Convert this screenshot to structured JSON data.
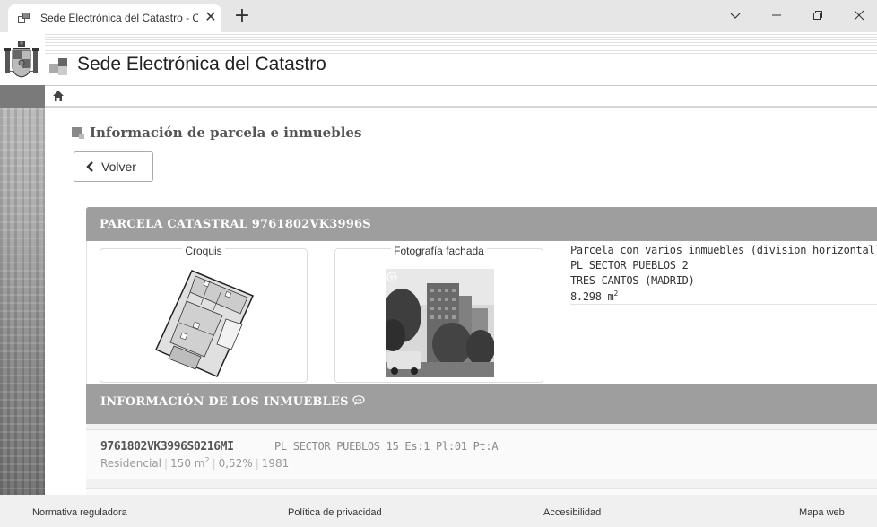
{
  "browser": {
    "tab_title": "Sede Electrónica del Catastro - C",
    "tab_close": "✕",
    "new_tab": "+"
  },
  "header": {
    "site_name": "Sede Electrónica del Catastro"
  },
  "page": {
    "title": "Información de parcela e inmuebles",
    "back_label": "Volver"
  },
  "parcel": {
    "heading": "PARCELA CATASTRAL 9761802VK3996S",
    "croquis_label": "Croquis",
    "photo_label": "Fotografía fachada",
    "description": "Parcela con varios inmuebles (division horizontal)",
    "address_line1": "PL SECTOR PUEBLOS 2",
    "address_line2": "TRES CANTOS (MADRID)",
    "surface": "8.298 m",
    "surface_unit_exp": "2"
  },
  "inmuebles": {
    "heading": "INFORMACIÓN DE LOS INMUEBLES",
    "items": [
      {
        "reference": "9761802VK3996S0216MI",
        "address": "PL SECTOR PUEBLOS 15 Es:1 Pl:01 Pt:A",
        "use": "Residencial",
        "surface": "150 m",
        "surface_exp": "2",
        "participation": "0,52%",
        "year": "1981"
      }
    ]
  },
  "footer": {
    "links": [
      "Normativa reguladora",
      "Política de privacidad",
      "Accesibilidad",
      "Mapa web"
    ]
  }
}
